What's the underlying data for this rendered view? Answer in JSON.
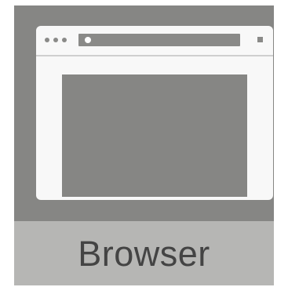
{
  "tile": {
    "label": "Browser",
    "icon": "browser-window-icon"
  },
  "colors": {
    "tile_background": "#868684",
    "label_background": "#b6b6b4",
    "window_background": "#f8f8f8",
    "label_text": "#444444"
  }
}
